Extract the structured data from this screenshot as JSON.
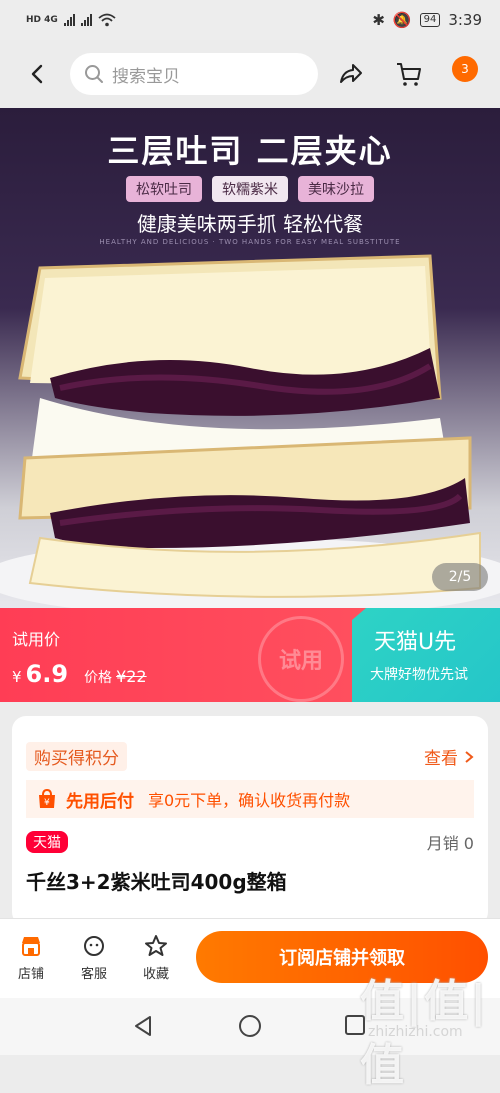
{
  "status_bar": {
    "network_left": "HD 4G",
    "battery": "94",
    "time": "3:39"
  },
  "nav": {
    "search_placeholder": "搜索宝贝",
    "more_badge": "3"
  },
  "hero": {
    "title": "三层吐司 二层夹心",
    "tags": [
      "松软吐司",
      "软糯紫米",
      "美味沙拉"
    ],
    "subtitle": "健康美味两手抓 轻松代餐",
    "tiny_text": "HEALTHY AND DELICIOUS · TWO HANDS FOR EASY MEAL SUBSTITUTE",
    "pager": "2/5"
  },
  "promo": {
    "trial_label": "试用价",
    "currency": "¥",
    "price": "6.9",
    "orig_label": "价格",
    "orig_price": "¥22",
    "stamp_text": "试用",
    "tmall_u_title": "天猫U先",
    "tmall_u_sub": "大牌好物优先试"
  },
  "info": {
    "points_label": "购买得积分",
    "view_label": "查看",
    "pay_after_title": "先用后付",
    "pay_after_desc": "享0元下单，确认收货再付款",
    "tmall_badge": "天猫",
    "monthly_sales": "月销 0",
    "product_title": "千丝3+2紫米吐司400g整箱"
  },
  "bottom_bar": {
    "store_label": "店铺",
    "service_label": "客服",
    "favorite_label": "收藏",
    "cta_label": "订阅店铺并领取"
  },
  "watermark": {
    "main": "值|值|值",
    "site": "zhizhizhi.com"
  },
  "colors": {
    "accent_orange": "#ff5000",
    "promo_red": "#ff3d55",
    "tmall_u_teal": "#2ed3c5"
  }
}
